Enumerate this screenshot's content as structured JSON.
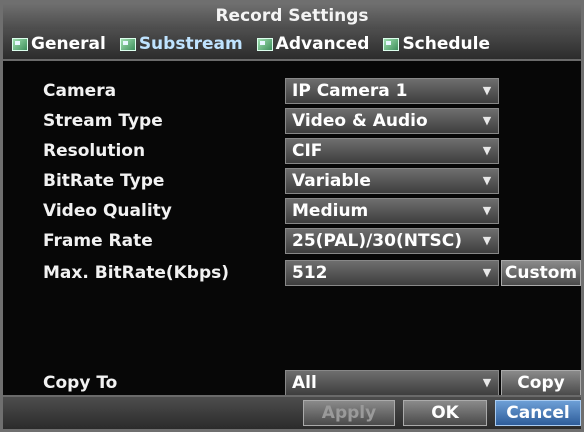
{
  "window": {
    "title": "Record Settings"
  },
  "tabs": [
    {
      "label": "General",
      "icon": "tab-icon"
    },
    {
      "label": "Substream",
      "icon": "tab-icon"
    },
    {
      "label": "Advanced",
      "icon": "tab-icon"
    },
    {
      "label": "Schedule",
      "icon": "tab-icon"
    }
  ],
  "active_tab": "Substream",
  "fields": {
    "camera": {
      "label": "Camera",
      "value": "IP Camera 1"
    },
    "stream_type": {
      "label": "Stream Type",
      "value": "Video & Audio"
    },
    "resolution": {
      "label": "Resolution",
      "value": "CIF"
    },
    "bitrate_type": {
      "label": "BitRate Type",
      "value": "Variable"
    },
    "video_quality": {
      "label": "Video Quality",
      "value": "Medium"
    },
    "frame_rate": {
      "label": "Frame Rate",
      "value": "25(PAL)/30(NTSC)"
    },
    "max_bitrate": {
      "label": "Max. BitRate(Kbps)",
      "value": "512",
      "button": "Custom"
    },
    "copy_to": {
      "label": "Copy To",
      "value": "All",
      "button": "Copy"
    }
  },
  "footer": {
    "apply": "Apply",
    "ok": "OK",
    "cancel": "Cancel"
  },
  "colors": {
    "accent": "#3d73b8",
    "panel": "#070707"
  },
  "caret_glyph": "▼"
}
